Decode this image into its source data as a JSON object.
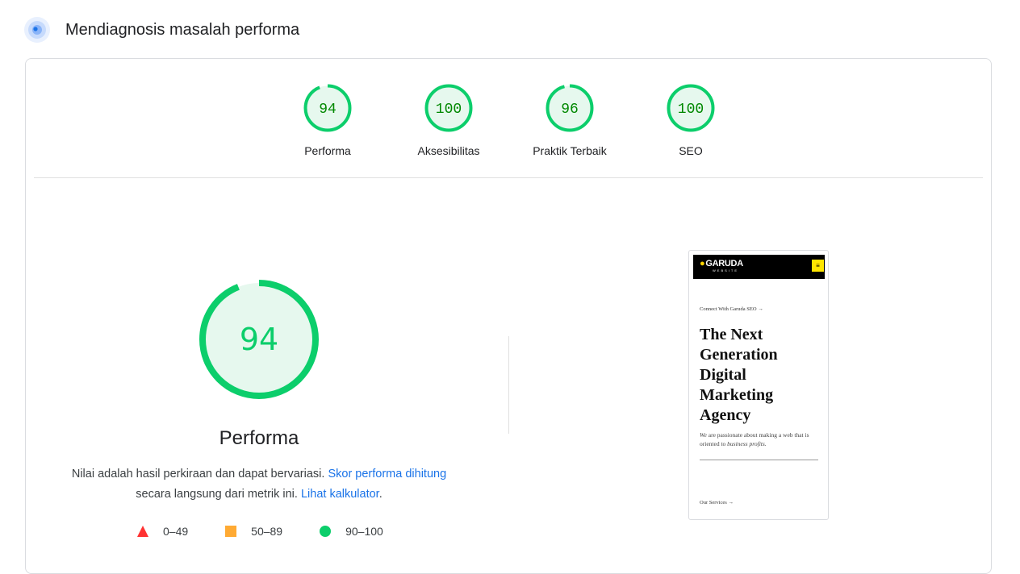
{
  "header": {
    "title": "Mendiagnosis masalah performa",
    "icon": "performance-insights-icon"
  },
  "gauges": [
    {
      "label": "Performa",
      "score": "94",
      "value": 94
    },
    {
      "label": "Aksesibilitas",
      "score": "100",
      "value": 100
    },
    {
      "label": "Praktik Terbaik",
      "score": "96",
      "value": 96
    },
    {
      "label": "SEO",
      "score": "100",
      "value": 100
    }
  ],
  "main": {
    "score": "94",
    "value": 94,
    "title": "Performa",
    "desc_text1": "Nilai adalah hasil perkiraan dan dapat bervariasi.",
    "desc_link1": "Skor performa dihitung",
    "desc_text2": "secara langsung dari metrik ini.",
    "desc_link2": "Lihat kalkulator",
    "desc_end": "."
  },
  "legend": [
    {
      "label": "0–49",
      "shape": "triangle",
      "color": "#ff3333"
    },
    {
      "label": "50–89",
      "shape": "square",
      "color": "#ffaa33"
    },
    {
      "label": "90–100",
      "shape": "circle",
      "color": "#0cce6b"
    }
  ],
  "screenshot": {
    "logo": "GARUDA",
    "logo_sub": "WEBSITE",
    "menu_icon": "≡",
    "connect": "Connect With Garuda SEO →",
    "hero_lines": [
      "The Next",
      "Generation",
      "Digital",
      "Marketing",
      "Agency"
    ],
    "sub_italic1": "We",
    "sub_text1": " are passionate about making a web that is oriented to ",
    "sub_italic2": "business profits.",
    "services": "Our Services →"
  },
  "colors": {
    "pass": "#0cce6b",
    "pass_bg": "#e6f8ee",
    "pass_text": "#008800",
    "link": "#1a73e8"
  }
}
